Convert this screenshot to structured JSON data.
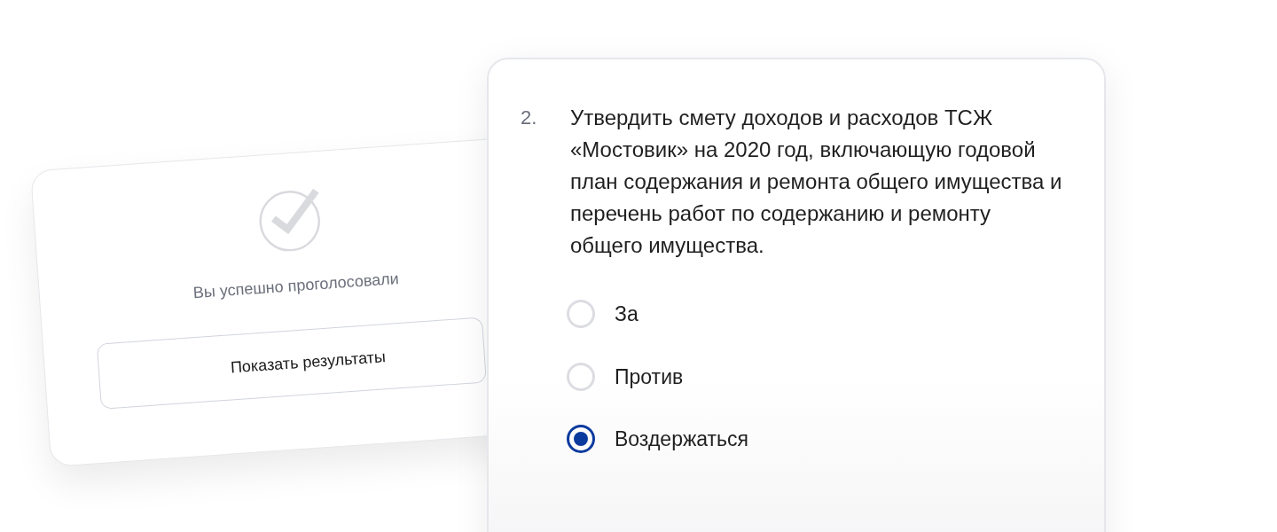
{
  "result_card": {
    "message": "Вы успешно проголосовали",
    "button": "Показать результаты"
  },
  "question_card": {
    "number": "2.",
    "text": "Утвердить смету доходов и расходов ТСЖ «Мостовик» на 2020 год, включающую годовой план содержания и ремонта общего имущества и перечень работ по содержанию и ремонту общего имущества.",
    "options": [
      {
        "label": "За",
        "selected": false
      },
      {
        "label": "Против",
        "selected": false
      },
      {
        "label": "Воздержаться",
        "selected": true
      }
    ]
  }
}
